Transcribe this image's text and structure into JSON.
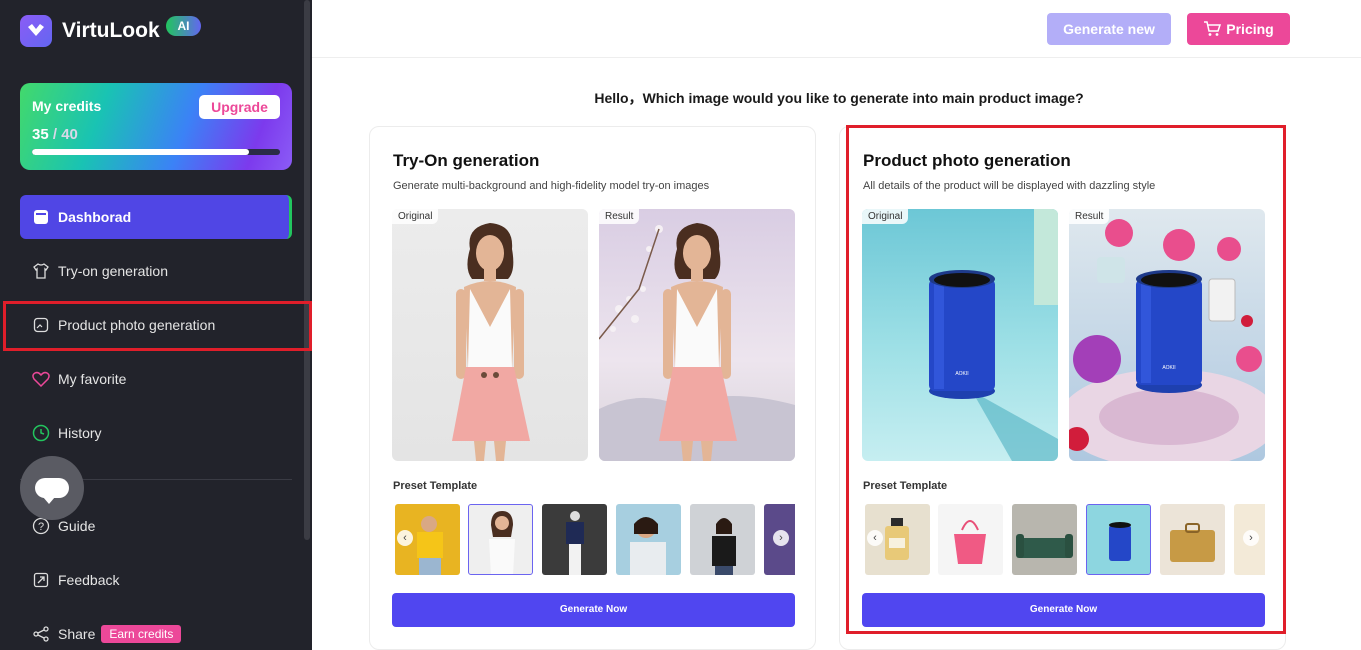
{
  "app": {
    "name": "VirtuLook",
    "badge": "AI"
  },
  "credits": {
    "title": "My credits",
    "used": "35",
    "total": " / 40",
    "fraction": 0.875,
    "upgrade_label": "Upgrade"
  },
  "nav": {
    "dashboard": "Dashborad",
    "tryon": "Try-on generation",
    "product": "Product photo generation",
    "favorite": "My favorite",
    "history": "History",
    "guide": "Guide",
    "feedback": "Feedback",
    "share": "Share",
    "earn_credits": "Earn credits"
  },
  "header": {
    "generate_new": "Generate new",
    "pricing": "Pricing"
  },
  "hello": "Hello，Which image would you like to generate into main product image?",
  "tryon_card": {
    "title": "Try-On generation",
    "subtitle": "Generate multi-background and high-fidelity model try-on images",
    "original_tag": "Original",
    "result_tag": "Result",
    "preset_label": "Preset Template",
    "button": "Generate Now"
  },
  "product_card": {
    "title": "Product photo generation",
    "subtitle": "All details of the product will be displayed with dazzling style",
    "original_tag": "Original",
    "result_tag": "Result",
    "preset_label": "Preset Template",
    "button": "Generate Now",
    "cup_label": "AOKII"
  },
  "colors": {
    "accent": "#5046f0",
    "pink": "#ec4899",
    "sidebar": "#22232b",
    "highlight": "#e01e2a"
  },
  "icons": [
    "logo-icon",
    "shirt-icon",
    "photo-icon",
    "heart-icon",
    "history-icon",
    "help-icon",
    "feedback-icon",
    "share-icon",
    "cart-icon",
    "chat-icon"
  ]
}
